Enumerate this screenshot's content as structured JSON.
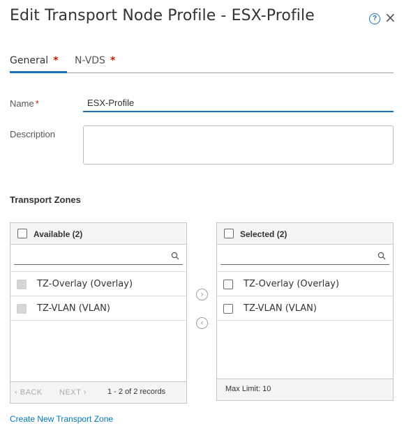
{
  "dialog": {
    "title": "Edit Transport Node Profile - ESX-Profile",
    "help_glyph": "?",
    "close_glyph": "×"
  },
  "tabs": [
    {
      "label": "General",
      "required_mark": "*",
      "active": true
    },
    {
      "label": "N-VDS",
      "required_mark": "*",
      "active": false
    }
  ],
  "form": {
    "name_label": "Name",
    "name_required": "*",
    "name_value": "ESX-Profile",
    "description_label": "Description",
    "description_value": ""
  },
  "transport_zones": {
    "section_title": "Transport Zones",
    "available": {
      "title": "Available (2)",
      "search_value": "",
      "items": [
        "TZ-Overlay (Overlay)",
        "TZ-VLAN (VLAN)"
      ],
      "pager_back": "BACK",
      "pager_next": "NEXT",
      "pager_back_glyph": "‹",
      "pager_next_glyph": "›",
      "records": "1 - 2 of 2 records"
    },
    "move_right_glyph": "›",
    "move_left_glyph": "‹",
    "selected": {
      "title": "Selected (2)",
      "search_value": "",
      "items": [
        "TZ-Overlay (Overlay)",
        "TZ-VLAN (VLAN)"
      ],
      "max_limit": "Max Limit: 10"
    }
  },
  "create_link": "Create New Transport Zone",
  "colors": {
    "accent": "#1b72b8",
    "required": "#c21d00",
    "link": "#0079b8",
    "panel_header": "#f5f5f5"
  },
  "icons": [
    "help-circle-icon",
    "close-icon",
    "search-icon",
    "chevron-right-circle-icon",
    "chevron-left-circle-icon"
  ]
}
